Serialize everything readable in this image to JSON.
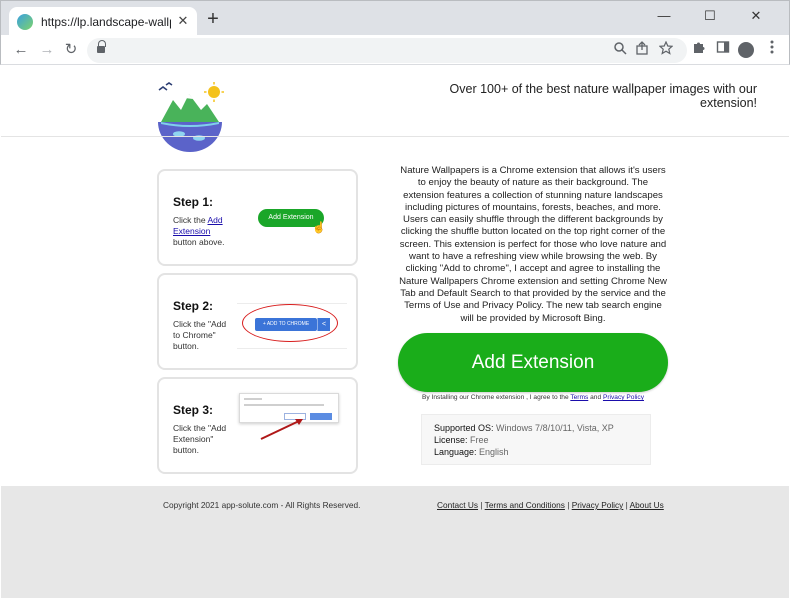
{
  "browser": {
    "tab_title": "https://lp.landscape-wallpaper.com",
    "tab_close": "✕",
    "new_tab": "+",
    "minimize": "—",
    "maximize": "☐",
    "close": "✕",
    "back": "←",
    "forward": "→",
    "reload": "↻"
  },
  "page": {
    "tagline": "Over 100+ of the best nature wallpaper images with our extension!",
    "steps": [
      {
        "title": "Step 1:",
        "desc_before": "Click the ",
        "desc_link": "Add Extension",
        "desc_after": " button above.",
        "button_label": "Add Extension"
      },
      {
        "title": "Step 2:",
        "desc": "Click the \"Add to Chrome\" button.",
        "button_label": "+ ADD TO CHROME"
      },
      {
        "title": "Step 3:",
        "desc": "Click the \"Add Extension\" button."
      }
    ],
    "description": "Nature Wallpapers is a Chrome extension that allows it's users to enjoy the beauty of nature as their background. The extension features a collection of stunning nature landscapes including pictures of mountains, forests, beaches, and more. Users can easily shuffle through the different backgrounds by clicking the shuffle button located on the top right corner of the screen. This extension is perfect for those who love nature and want to have a refreshing view while browsing the web. By clicking \"Add to chrome\", I accept and agree to installing the Nature Wallpapers Chrome extension and setting Chrome New Tab and Default Search to that provided by the service and the Terms of Use and Privacy Policy. The new tab search engine will be provided by Microsoft Bing.",
    "add_button": "Add Extension",
    "agree_text": "By Installing our Chrome extension , I agree to the ",
    "agree_terms": "Terms",
    "agree_and": " and ",
    "agree_privacy": "Privacy Policy",
    "info": {
      "os_label": "Supported OS:",
      "os_value": " Windows 7/8/10/11, Vista, XP",
      "license_label": "License:",
      "license_value": " Free",
      "language_label": "Language:",
      "language_value": " English"
    },
    "footer": {
      "copyright": "Copyright 2021 app-solute.com - All Rights Reserved.",
      "contact": "Contact Us",
      "terms": "Terms and Conditions",
      "privacy": "Privacy Policy",
      "about": "About Us",
      "sep": " | "
    }
  },
  "colors": {
    "accent_green": "#1aad1a",
    "link_blue": "#1a0dab",
    "highlight_red": "#d81e1e"
  }
}
